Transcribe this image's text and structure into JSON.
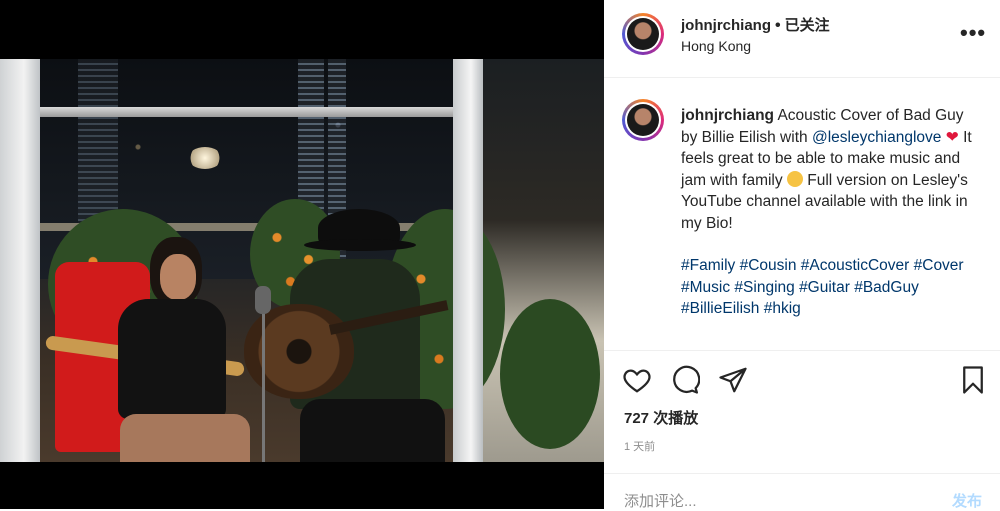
{
  "header": {
    "username": "johnjrchiang",
    "separator": "•",
    "follow_status": "已关注",
    "location": "Hong Kong",
    "more_label": "•••"
  },
  "caption": {
    "username": "johnjrchiang",
    "text1": "Acoustic Cover of Bad Guy by Billie Eilish with",
    "mention": "@lesleychianglove",
    "heart_emoji": "❤",
    "text2": "It feels great to be able to make music and jam with family",
    "text3": "Full version on Lesley's YouTube channel available with the link in my Bio!",
    "hashtags": [
      "#Family",
      "#Cousin",
      "#AcousticCover",
      "#Cover",
      "#Music",
      "#Singing",
      "#Guitar",
      "#BadGuy",
      "#BillieEilish",
      "#hkig"
    ]
  },
  "actions": {
    "icons": [
      "heart-icon",
      "comment-icon",
      "share-icon",
      "bookmark-icon"
    ],
    "views": "727 次播放",
    "time": "1 天前"
  },
  "comment": {
    "placeholder": "添加评论...",
    "post_label": "发布"
  },
  "colors": {
    "link": "#00376b",
    "muted": "#8e8e8e",
    "post_button": "#b3dbff",
    "heart": "#e0173c"
  }
}
